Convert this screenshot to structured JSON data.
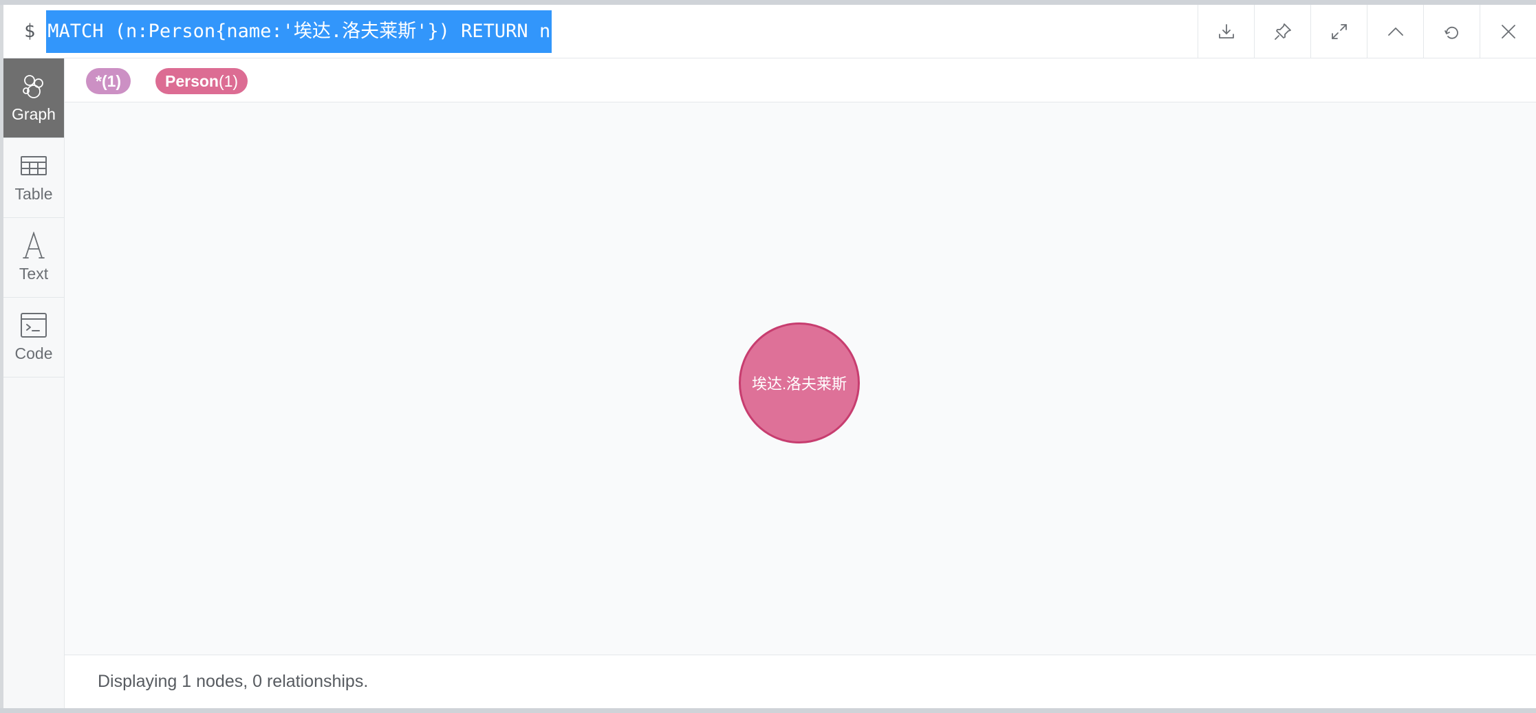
{
  "query": {
    "prompt": "$",
    "text": "MATCH (n:Person{name:'埃达.洛夫莱斯'}) RETURN n"
  },
  "actions": [
    {
      "name": "download-icon"
    },
    {
      "name": "pin-icon"
    },
    {
      "name": "expand-icon"
    },
    {
      "name": "collapse-up-icon"
    },
    {
      "name": "rerun-icon"
    },
    {
      "name": "close-icon"
    }
  ],
  "sidebar": {
    "tabs": [
      {
        "label": "Graph",
        "icon": "graph-icon",
        "active": true
      },
      {
        "label": "Table",
        "icon": "table-icon"
      },
      {
        "label": "Text",
        "icon": "text-icon"
      },
      {
        "label": "Code",
        "icon": "code-icon"
      }
    ]
  },
  "labels": [
    {
      "text": "*(1)",
      "color": "#cc90c4"
    },
    {
      "name": "Person",
      "count": "(1)",
      "color": "#dc6c93"
    }
  ],
  "graph": {
    "node": {
      "label": "埃达.洛夫莱斯",
      "fill": "#de7198",
      "stroke": "#c73d6f"
    }
  },
  "footer": {
    "status": "Displaying 1 nodes, 0 relationships."
  }
}
